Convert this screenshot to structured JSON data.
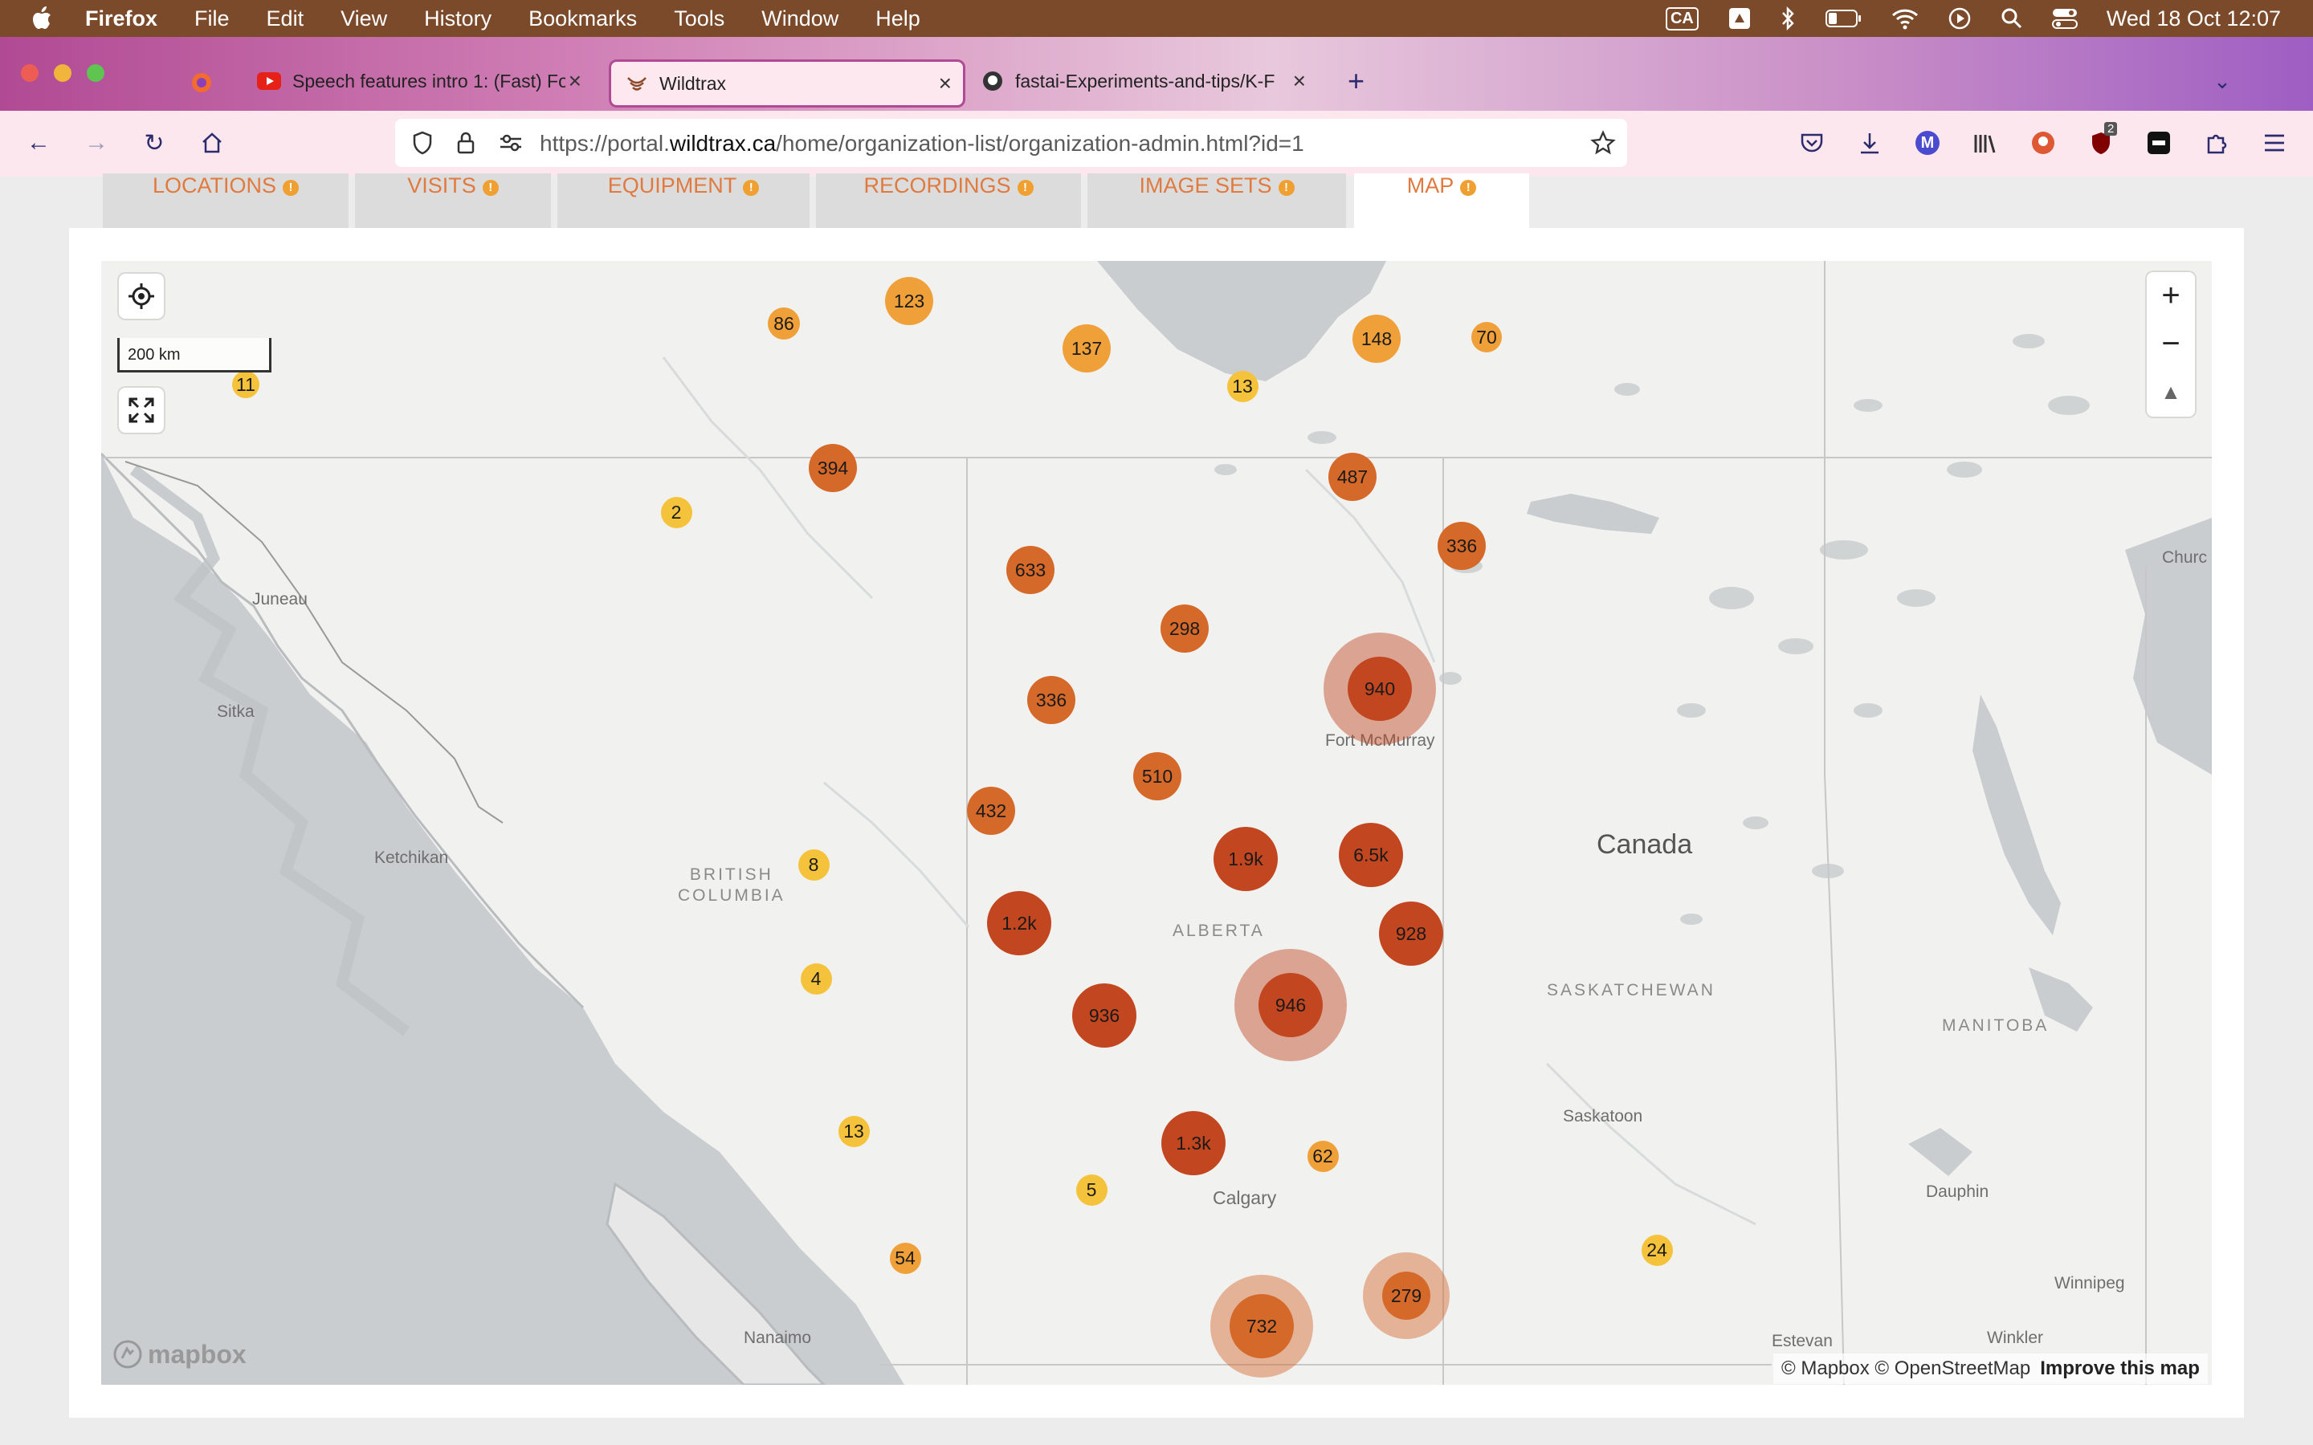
{
  "menubar": {
    "app": "Firefox",
    "items": [
      "File",
      "Edit",
      "View",
      "History",
      "Bookmarks",
      "Tools",
      "Window",
      "Help"
    ],
    "input_source": "CA",
    "clock": "Wed 18 Oct  12:07"
  },
  "tabs": [
    {
      "title": "Speech features intro 1: (Fast) Fo",
      "icon": "youtube-icon",
      "active": false
    },
    {
      "title": "Wildtrax",
      "icon": "wildtrax-icon",
      "active": true
    },
    {
      "title": "fastai-Experiments-and-tips/K-F",
      "icon": "github-icon",
      "active": false
    }
  ],
  "toolbar": {
    "url_prefix": "https://portal.",
    "url_host": "wildtrax.ca",
    "url_path": "/home/organization-list/organization-admin.html?id=1",
    "extension_badge": "2",
    "profile_letter": "M"
  },
  "page_tabs": [
    {
      "label": "LOCATIONS",
      "active": false
    },
    {
      "label": "VISITS",
      "active": false
    },
    {
      "label": "EQUIPMENT",
      "active": false
    },
    {
      "label": "RECORDINGS",
      "active": false
    },
    {
      "label": "IMAGE SETS",
      "active": false
    },
    {
      "label": "MAP",
      "active": true
    }
  ],
  "map": {
    "scale_label": "200 km",
    "country_label": "Canada",
    "province_labels": [
      "BRITISH\nCOLUMBIA",
      "ALBERTA",
      "SASKATCHEWAN",
      "MANITOBA"
    ],
    "place_labels": [
      "Juneau",
      "Sitka",
      "Ketchikan",
      "Nanaimo",
      "Calgary",
      "Saskatoon",
      "Dauphin",
      "Winnipeg",
      "Winkler",
      "Estevan",
      "Churc",
      "Fort McMurray"
    ],
    "attribution": "© Mapbox © OpenStreetMap",
    "improve_link": "Improve this map",
    "logo_text": "mapbox",
    "clusters": [
      "11",
      "86",
      "123",
      "137",
      "13",
      "148",
      "70",
      "394",
      "2",
      "487",
      "633",
      "336",
      "298",
      "940",
      "336",
      "510",
      "432",
      "8",
      "1.9k",
      "6.5k",
      "1.2k",
      "928",
      "4",
      "936",
      "946",
      "1.3k",
      "62",
      "13",
      "5",
      "54",
      "24",
      "732",
      "279"
    ],
    "colors": {
      "small": "#f5c33b",
      "medium": "#f0a038",
      "large": "#d5692a",
      "xlarge": "#c2461f"
    }
  }
}
